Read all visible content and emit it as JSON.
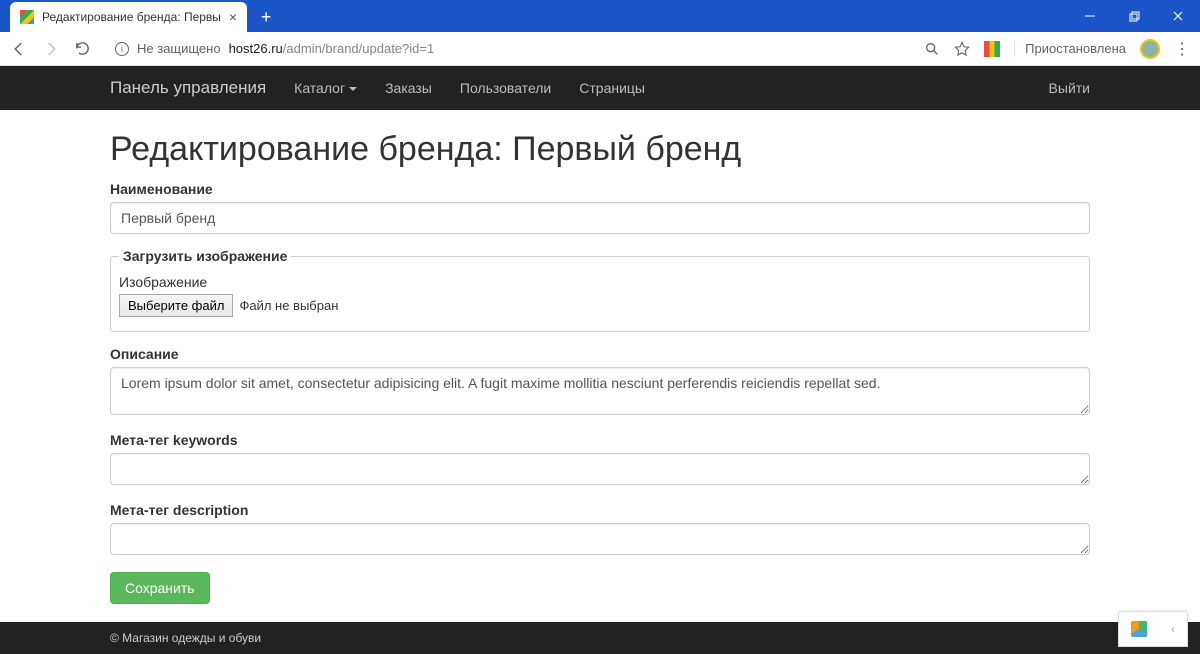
{
  "browser": {
    "tab_title": "Редактирование бренда: Первы",
    "insecure_label": "Не защищено",
    "url_host": "host26.ru",
    "url_path": "/admin/brand/update?id=1",
    "paused_label": "Приостановлена"
  },
  "navbar": {
    "brand": "Панель управления",
    "items": [
      {
        "label": "Каталог",
        "dropdown": true
      },
      {
        "label": "Заказы"
      },
      {
        "label": "Пользователи"
      },
      {
        "label": "Страницы"
      }
    ],
    "logout": "Выйти"
  },
  "page": {
    "title": "Редактирование бренда: Первый бренд",
    "labels": {
      "name": "Наименование",
      "upload_legend": "Загрузить изображение",
      "image": "Изображение",
      "file_button": "Выберите файл",
      "file_status": "Файл не выбран",
      "description": "Описание",
      "meta_keywords": "Мета-тег keywords",
      "meta_description": "Мета-тег description",
      "save": "Сохранить"
    },
    "values": {
      "name": "Первый бренд",
      "description": "Lorem ipsum dolor sit amet, consectetur adipisicing elit. A fugit maxime mollitia nesciunt perferendis reiciendis repellat sed.",
      "meta_keywords": "",
      "meta_description": ""
    }
  },
  "footer": {
    "copyright": "© Магазин одежды и обуви"
  }
}
